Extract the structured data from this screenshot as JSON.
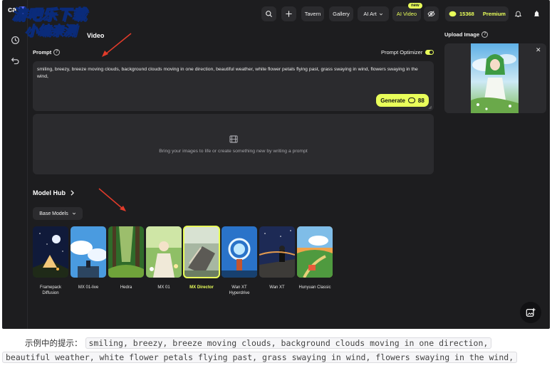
{
  "app": {
    "brand": "ca",
    "tab_video": "Video",
    "watermark": {
      "line1": "游吧乐下载",
      "line2": "小编亲测"
    }
  },
  "topbar": {
    "tavern": "Tavern",
    "gallery": "Gallery",
    "ai_art": "AI Art",
    "ai_video": "AI Video",
    "new_badge": "new",
    "credits": "15368",
    "premium": "Premium"
  },
  "prompt": {
    "label": "Prompt",
    "optimizer_label": "Prompt Optimizer",
    "optimizer_on": true,
    "text": "smiling, breezy, breeze moving clouds, background clouds moving in one direction, beautiful weather, white flower petals flying past, grass swaying in wind, flowers swaying in the wind,",
    "generate_label": "Generate",
    "generate_cost": "88"
  },
  "preview": {
    "hint": "Bring your images to life or create something new by writing a prompt"
  },
  "upload": {
    "label": "Upload Image"
  },
  "model_hub": {
    "title": "Model Hub",
    "filter": "Base Models",
    "models": [
      {
        "line1": "Framepack",
        "line2": "Diffusion",
        "selected": false
      },
      {
        "line1": "MX 01-live",
        "line2": "",
        "selected": false
      },
      {
        "line1": "Hedra",
        "line2": "",
        "selected": false
      },
      {
        "line1": "MX 01",
        "line2": "",
        "selected": false
      },
      {
        "line1": "MX Director",
        "line2": "",
        "selected": true
      },
      {
        "line1": "Wan XT",
        "line2": "Hyperdrive",
        "selected": false
      },
      {
        "line1": "Wan XT",
        "line2": "",
        "selected": false
      },
      {
        "line1": "Hunyuan Classic",
        "line2": "",
        "selected": false
      }
    ]
  },
  "caption": {
    "prefix": "示例中的提示：",
    "code_line1": "smiling, breezy, breeze moving clouds, background clouds moving in one direction,",
    "code_line2": "beautiful weather, white flower petals flying past, grass swaying in wind, flowers swaying in the wind,"
  },
  "colors": {
    "accent": "#e9ff5a",
    "panel": "#2b2b2e",
    "background": "#1d1d1f",
    "annotation_arrow": "#e23b2a"
  }
}
